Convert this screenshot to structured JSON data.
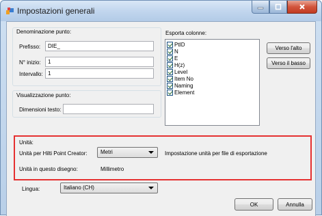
{
  "window": {
    "title": "Impostazioni generali"
  },
  "naming": {
    "group_label": "Denominazione punto:",
    "prefix_label": "Prefisso:",
    "prefix_value": "DIE_",
    "start_label": "N° inizio:",
    "start_value": "1",
    "interval_label": "Intervallo:",
    "interval_value": "1"
  },
  "display": {
    "group_label": "Visualizzazione punto:",
    "text_size_label": "Dimensioni testo:",
    "text_size_value": ""
  },
  "export": {
    "group_label": "Esporta colonne:",
    "columns": [
      {
        "label": "PtID",
        "checked": true
      },
      {
        "label": "N",
        "checked": true
      },
      {
        "label": "E",
        "checked": true
      },
      {
        "label": "H(z)",
        "checked": true
      },
      {
        "label": "Level",
        "checked": true
      },
      {
        "label": "Item No",
        "checked": true
      },
      {
        "label": "Naming",
        "checked": true
      },
      {
        "label": "Element",
        "checked": true
      }
    ],
    "up_button": "Verso l'alto",
    "down_button": "Verso il basso"
  },
  "units": {
    "group_label": "Unità:",
    "hpc_label": "Unità per Hilti Point Creator:",
    "hpc_value": "Metri",
    "export_note": "Impostazione unità per file di esportazione",
    "drawing_label": "Unità in questo disegno:",
    "drawing_value": "Millimetro"
  },
  "language": {
    "label": "Lingua:",
    "value": "Italiano (CH)"
  },
  "footer": {
    "ok": "OK",
    "cancel": "Annulla"
  },
  "colors": {
    "highlight": "#e53030",
    "title_bar": "#c2d6ee",
    "client_bg": "#f0f0f0",
    "close_button": "#c13a22"
  }
}
